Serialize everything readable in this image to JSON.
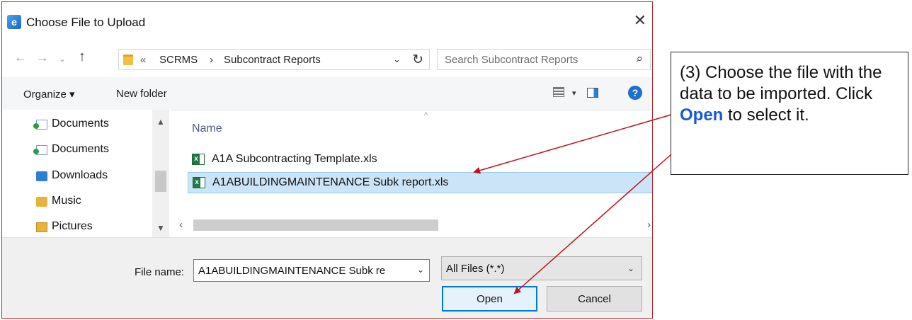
{
  "window": {
    "title": "Choose File to Upload",
    "app_icon_glyph": "e"
  },
  "address": {
    "overflow": "«",
    "crumbs": [
      "SCRMS",
      "Subcontract Reports"
    ],
    "separator": "›",
    "search_placeholder": "Search Subcontract Reports"
  },
  "toolbar": {
    "organize_label": "Organize ▾",
    "new_folder_label": "New folder",
    "help_glyph": "?"
  },
  "nav_pane": {
    "items": [
      {
        "label": "Documents",
        "icon": "documents-icon"
      },
      {
        "label": "Documents",
        "icon": "documents-icon"
      },
      {
        "label": "Downloads",
        "icon": "downloads-icon"
      },
      {
        "label": "Music",
        "icon": "music-icon"
      },
      {
        "label": "Pictures",
        "icon": "pictures-icon"
      }
    ]
  },
  "file_list": {
    "column_name": "Name",
    "files": [
      {
        "name": "A1A Subcontracting Template.xls",
        "selected": false
      },
      {
        "name": "A1ABUILDINGMAINTENANCE Subk report.xls",
        "selected": true
      }
    ]
  },
  "bottom": {
    "file_name_label": "File name:",
    "file_name_value": "A1ABUILDINGMAINTENANCE Subk re",
    "file_type_value": "All Files (*.*)",
    "open_label": "Open",
    "cancel_label": "Cancel"
  },
  "callout": {
    "text_before": "(3) Choose the file with the data to be imported.  Click ",
    "highlight": "Open",
    "text_after": " to select it.",
    "highlight_color": "#1659d9"
  },
  "colors": {
    "dialog_border": "#b02a2a",
    "selection_bg": "#cce4f7",
    "arrow": "#c0121b"
  }
}
